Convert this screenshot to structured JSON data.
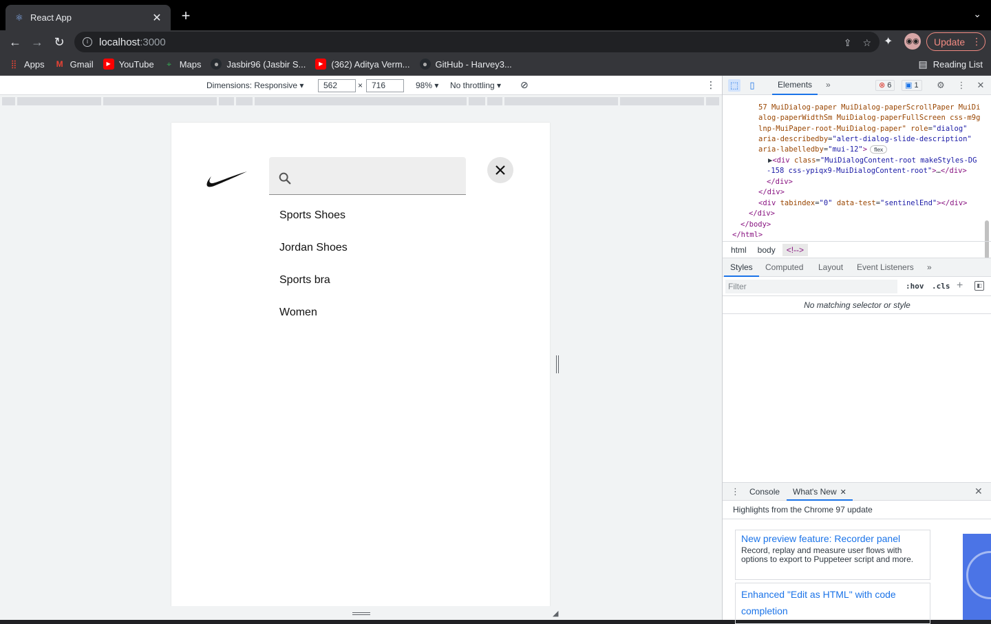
{
  "browser": {
    "tab_title": "React App",
    "url_host": "localhost",
    "url_port": ":3000",
    "update_label": "Update",
    "reading_list_label": "Reading List",
    "bookmarks": [
      {
        "label": "Apps",
        "icon": "apps-grid-icon"
      },
      {
        "label": "Gmail",
        "icon": "gmail-icon"
      },
      {
        "label": "YouTube",
        "icon": "youtube-icon"
      },
      {
        "label": "Maps",
        "icon": "maps-icon"
      },
      {
        "label": "Jasbir96 (Jasbir S...",
        "icon": "github-icon"
      },
      {
        "label": "(362) Aditya Verm...",
        "icon": "youtube-icon"
      },
      {
        "label": "GitHub - Harvey3...",
        "icon": "github-icon"
      }
    ]
  },
  "device_toolbar": {
    "dimensions_label": "Dimensions: Responsive ▾",
    "width": "562",
    "times": "×",
    "height": "716",
    "zoom": "98% ▾",
    "throttle": "No throttling ▾"
  },
  "page": {
    "search_value": "",
    "suggestions": [
      "Sports Shoes",
      "Jordan Shoes",
      "Sports bra",
      "Women"
    ]
  },
  "devtools": {
    "main_tab": "Elements",
    "error_count": "6",
    "message_count": "1",
    "dom_lines": [
      {
        "indent": 52,
        "parts": [
          [
            "attr",
            "57 MuiDialog-paper MuiDialog-paperScrollPaper MuiDi"
          ]
        ]
      },
      {
        "indent": 52,
        "parts": [
          [
            "attr",
            "alog-paperWidthSm MuiDialog-paperFullScreen css-m9g"
          ]
        ]
      },
      {
        "indent": 52,
        "parts": [
          [
            "attr",
            "lnp-MuiPaper-root-MuiDialog-paper\" "
          ],
          [
            "attr",
            "role"
          ],
          [
            "txt",
            "="
          ],
          [
            "val",
            "\"dialog\""
          ]
        ]
      },
      {
        "indent": 52,
        "parts": [
          [
            "attr",
            "aria-describedby"
          ],
          [
            "txt",
            "="
          ],
          [
            "val",
            "\"alert-dialog-slide-description\""
          ]
        ]
      },
      {
        "indent": 52,
        "parts": [
          [
            "attr",
            "aria-labelledby"
          ],
          [
            "txt",
            "="
          ],
          [
            "val",
            "\"mui-12\""
          ],
          [
            "tag",
            ">"
          ]
        ],
        "badge": "flex"
      },
      {
        "indent": 66,
        "parts": [
          [
            "txt",
            "▶"
          ],
          [
            "tag",
            "<div "
          ],
          [
            "attr",
            "class"
          ],
          [
            "txt",
            "="
          ],
          [
            "val",
            "\"MuiDialogContent-root makeStyles-DG"
          ]
        ]
      },
      {
        "indent": 64,
        "parts": [
          [
            "val",
            "-158 css-ypiqx9-MuiDialogContent-root\""
          ],
          [
            "tag",
            ">"
          ],
          [
            "txt",
            "…"
          ],
          [
            "tag",
            "</div>"
          ]
        ]
      },
      {
        "indent": 64,
        "parts": [
          [
            "tag",
            "</div>"
          ]
        ]
      },
      {
        "indent": 52,
        "parts": [
          [
            "tag",
            "</div>"
          ]
        ]
      },
      {
        "indent": 52,
        "parts": [
          [
            "tag",
            "<div "
          ],
          [
            "attr",
            "tabindex"
          ],
          [
            "txt",
            "="
          ],
          [
            "val",
            "\"0\" "
          ],
          [
            "attr",
            "data-test"
          ],
          [
            "txt",
            "="
          ],
          [
            "val",
            "\"sentinelEnd\""
          ],
          [
            "tag",
            "></div>"
          ]
        ]
      },
      {
        "indent": 38,
        "parts": [
          [
            "tag",
            "</div>"
          ]
        ]
      },
      {
        "indent": 26,
        "parts": [
          [
            "tag",
            "</body>"
          ]
        ]
      },
      {
        "indent": 14,
        "parts": [
          [
            "tag",
            "</html>"
          ]
        ]
      }
    ],
    "breadcrumbs": [
      "html",
      "body",
      "<!-->"
    ],
    "subtabs": [
      "Styles",
      "Computed",
      "Layout",
      "Event Listeners"
    ],
    "filter_placeholder": "Filter",
    "hov_label": ":hov",
    "cls_label": ".cls",
    "no_match": "No matching selector or style",
    "drawer_tabs": [
      "Console",
      "What's New"
    ],
    "highlights": "Highlights from the Chrome 97 update",
    "cards": [
      {
        "title": "New preview feature: Recorder panel",
        "desc": "Record, replay and measure user flows with options to export to Puppeteer script and more."
      },
      {
        "title": "Enhanced \"Edit as HTML\" with code completion",
        "desc": ""
      }
    ]
  }
}
